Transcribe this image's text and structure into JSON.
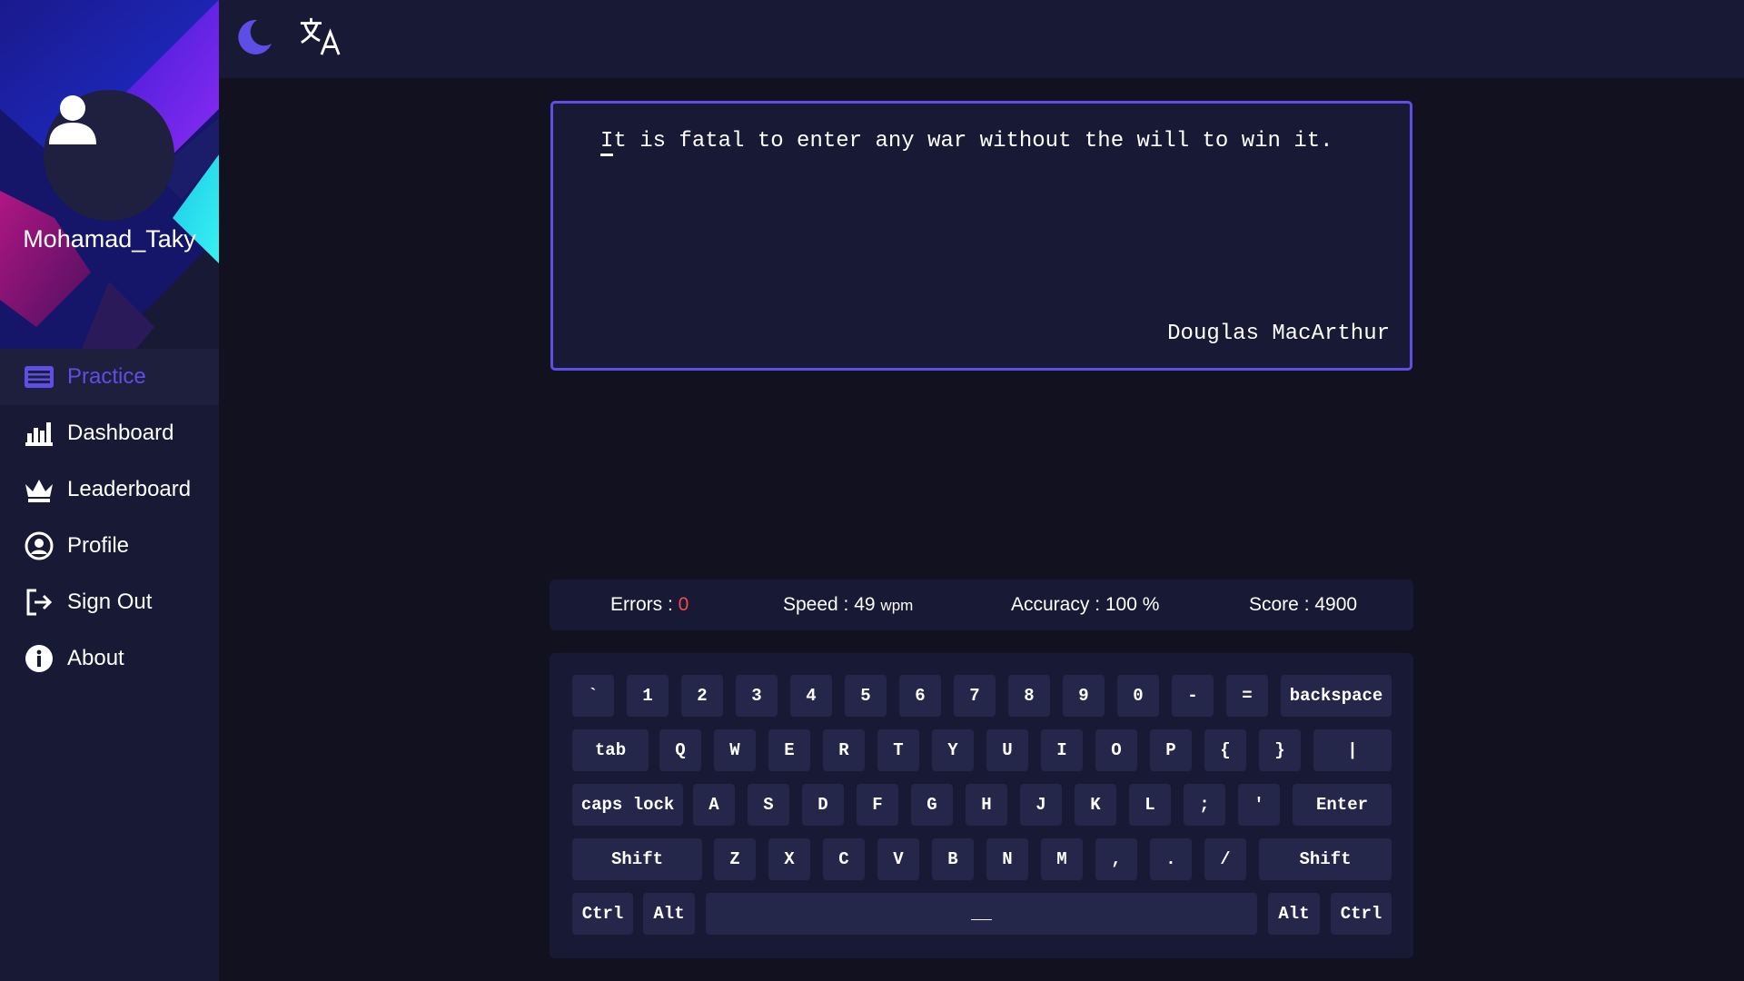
{
  "sidebar": {
    "username": "Mohamad_Taky",
    "items": [
      {
        "label": "Practice",
        "icon": "keyboard-icon",
        "active": true
      },
      {
        "label": "Dashboard",
        "icon": "bar-chart-icon"
      },
      {
        "label": "Leaderboard",
        "icon": "crown-icon"
      },
      {
        "label": "Profile",
        "icon": "user-circle-icon"
      },
      {
        "label": "Sign Out",
        "icon": "sign-out-icon"
      },
      {
        "label": "About",
        "icon": "info-icon"
      }
    ]
  },
  "topbar": {
    "icons": [
      "moon-icon",
      "translate-icon"
    ]
  },
  "quote": {
    "first_char": "I",
    "rest": "t is fatal to enter any war without the will to win it.",
    "author": "Douglas MacArthur"
  },
  "stats": {
    "errors_label": "Errors : ",
    "errors_value": "0",
    "speed_label": "Speed : 49 ",
    "speed_unit": "wpm",
    "accuracy": "Accuracy : 100 %",
    "score": "Score : 4900"
  },
  "keyboard": {
    "rows": [
      [
        "`",
        "1",
        "2",
        "3",
        "4",
        "5",
        "6",
        "7",
        "8",
        "9",
        "0",
        "-",
        "=",
        "backspace"
      ],
      [
        "tab",
        "Q",
        "W",
        "E",
        "R",
        "T",
        "Y",
        "U",
        "I",
        "O",
        "P",
        "{",
        "}",
        "|"
      ],
      [
        "caps lock",
        "A",
        "S",
        "D",
        "F",
        "G",
        "H",
        "J",
        "K",
        "L",
        ";",
        "'",
        "Enter"
      ],
      [
        "Shift",
        "Z",
        "X",
        "C",
        "V",
        "B",
        "N",
        "M",
        ",",
        ".",
        "/",
        "Shift"
      ],
      [
        "Ctrl",
        "Alt",
        "__",
        "Alt",
        "Ctrl"
      ]
    ]
  },
  "colors": {
    "accent": "#5d4fe6",
    "background": "#11111f",
    "panel": "#181934",
    "key": "#24264a",
    "error": "#f04c4c"
  }
}
